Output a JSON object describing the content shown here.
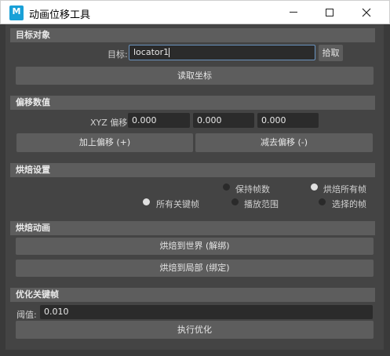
{
  "window": {
    "title": "动画位移工具",
    "icon_label": "M"
  },
  "target": {
    "header": "目标对象",
    "label": "目标:",
    "value": "locator1",
    "pick_button": "拾取",
    "read_button": "读取坐标"
  },
  "offset": {
    "header": "偏移数值",
    "label": "XYZ 偏移:",
    "x": "0.000",
    "y": "0.000",
    "z": "0.000",
    "add_button": "加上偏移 (+)",
    "sub_button": "减去偏移 (-)"
  },
  "bake_settings": {
    "header": "烘焙设置",
    "options": [
      {
        "label": "保持帧数",
        "selected": false
      },
      {
        "label": "烘焙所有帧",
        "selected": true
      },
      {
        "label": "所有关键帧",
        "selected": true
      },
      {
        "label": "播放范围",
        "selected": false
      },
      {
        "label": "选择的帧",
        "selected": false
      }
    ]
  },
  "bake_anim": {
    "header": "烘焙动画",
    "world_button": "烘焙到世界 (解绑)",
    "local_button": "烘焙到局部 (绑定)"
  },
  "optimize": {
    "header": "优化关键帧",
    "threshold_label": "阈值:",
    "threshold_value": "0.010",
    "run_button": "执行优化"
  }
}
